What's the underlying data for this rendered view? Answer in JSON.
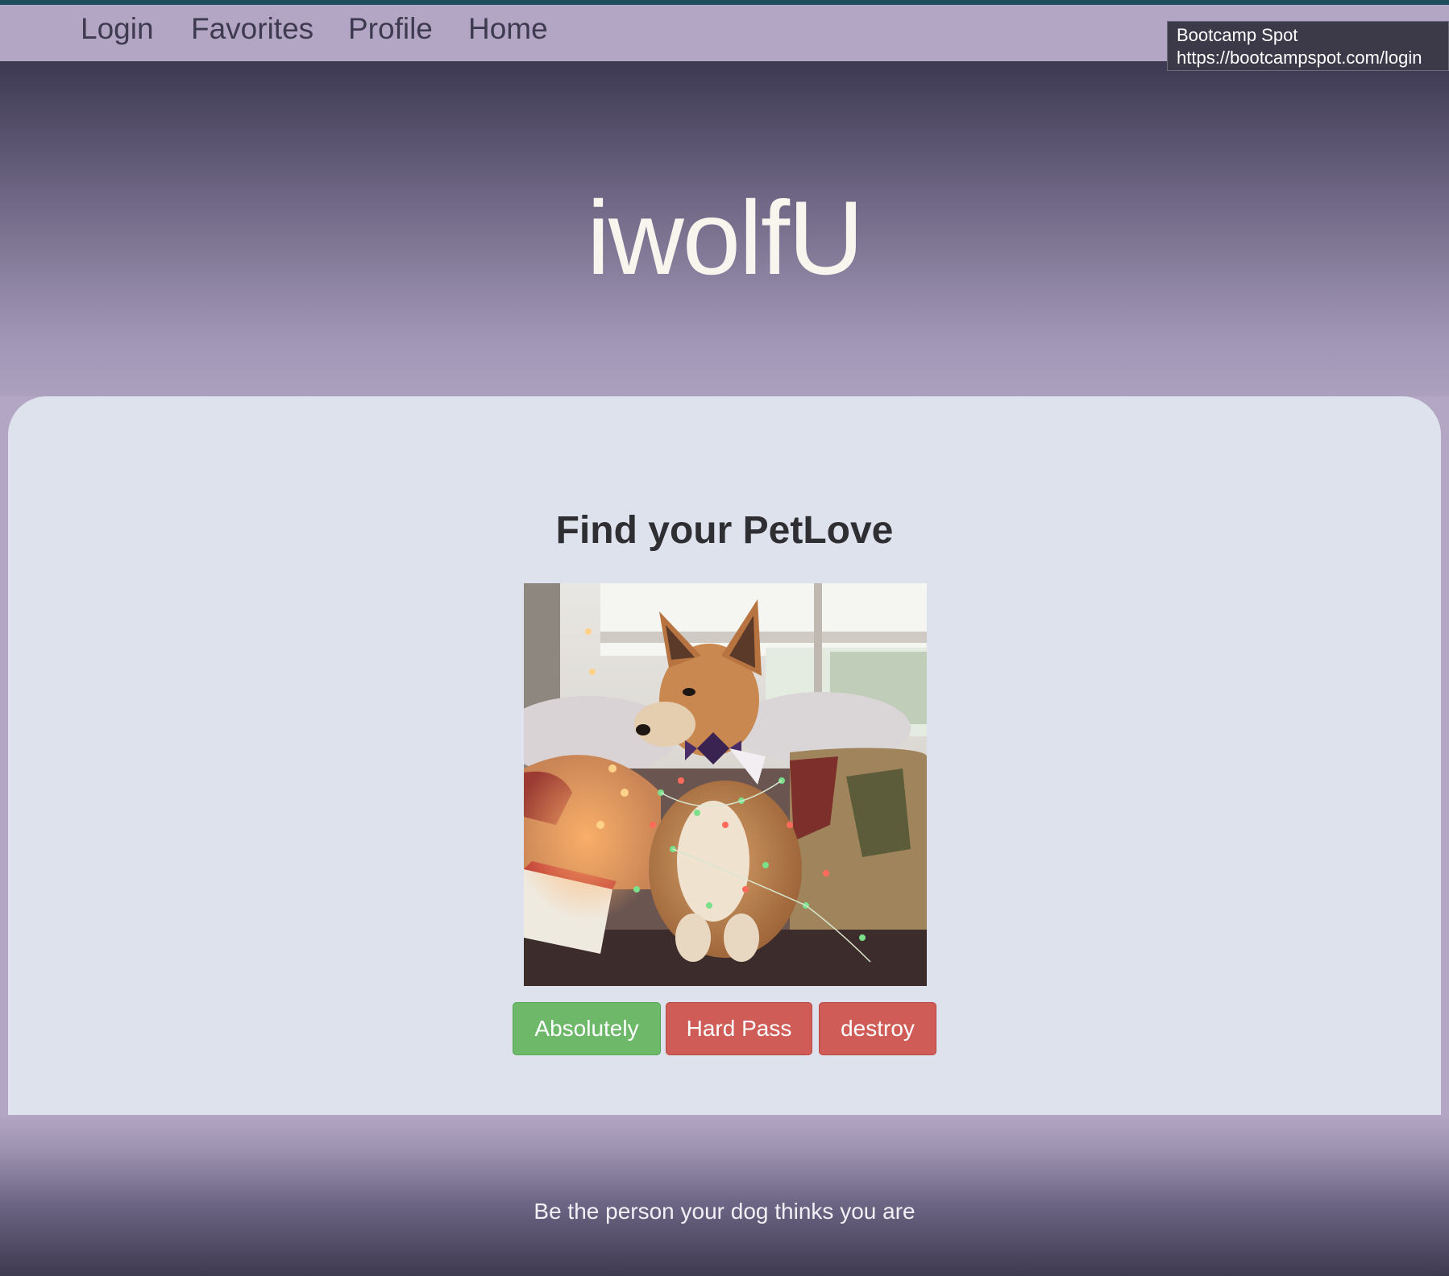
{
  "nav": {
    "items": [
      {
        "label": "Login"
      },
      {
        "label": "Favorites"
      },
      {
        "label": "Profile"
      },
      {
        "label": "Home"
      }
    ]
  },
  "tooltip": {
    "title": "Bootcamp Spot",
    "url": "https://bootcampspot.com/login"
  },
  "hero": {
    "title": "iwolfU"
  },
  "card": {
    "title": "Find your PetLove",
    "image_description": "shiba-inu-dog-with-christmas-lights",
    "buttons": {
      "absolutely": "Absolutely",
      "hard_pass": "Hard Pass",
      "destroy": "destroy"
    }
  },
  "footer": {
    "tagline": "Be the person your dog thinks you are"
  },
  "colors": {
    "nav_bg": "#b3a6c5",
    "accent_green": "#6eb86a",
    "accent_red": "#cf5c56",
    "card_bg": "#dde2ed",
    "hero_dark": "#3d3952"
  }
}
